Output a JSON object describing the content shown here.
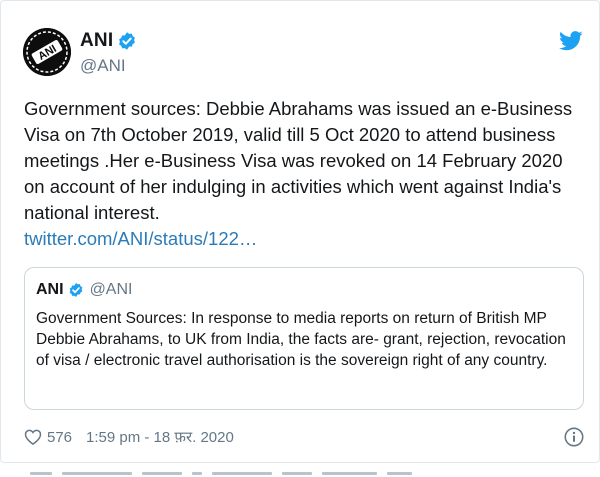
{
  "tweet": {
    "author_name": "ANI",
    "author_handle": "@ANI",
    "text": "Government sources: Debbie Abrahams was issued an e-Business Visa on 7th October 2019, valid till 5 Oct 2020 to attend business meetings .Her e-Business Visa was revoked on 14 February 2020 on account of her indulging in activities which went against India's national interest.",
    "link": "twitter.com/ANI/status/122…",
    "likes": "576",
    "timestamp": "1:59 pm - 18 फ़र. 2020",
    "avatar_text": "ANI"
  },
  "quote": {
    "author_name": "ANI",
    "author_handle": "@ANI",
    "text": "Government Sources: In response to media reports on return of British MP Debbie Abrahams, to UK from India, the facts are- grant, rejection, revocation of visa / electronic travel authorisation is the sovereign right of any country."
  },
  "icons": {
    "verified": "verified-badge-icon",
    "twitter": "twitter-bird-icon",
    "like": "heart-icon",
    "info": "info-icon"
  },
  "colors": {
    "verified": "#1da1f2",
    "twitter": "#1da1f2",
    "link": "#2b7bb9",
    "secondary_text": "#657786",
    "border": "#ccd6dd"
  }
}
